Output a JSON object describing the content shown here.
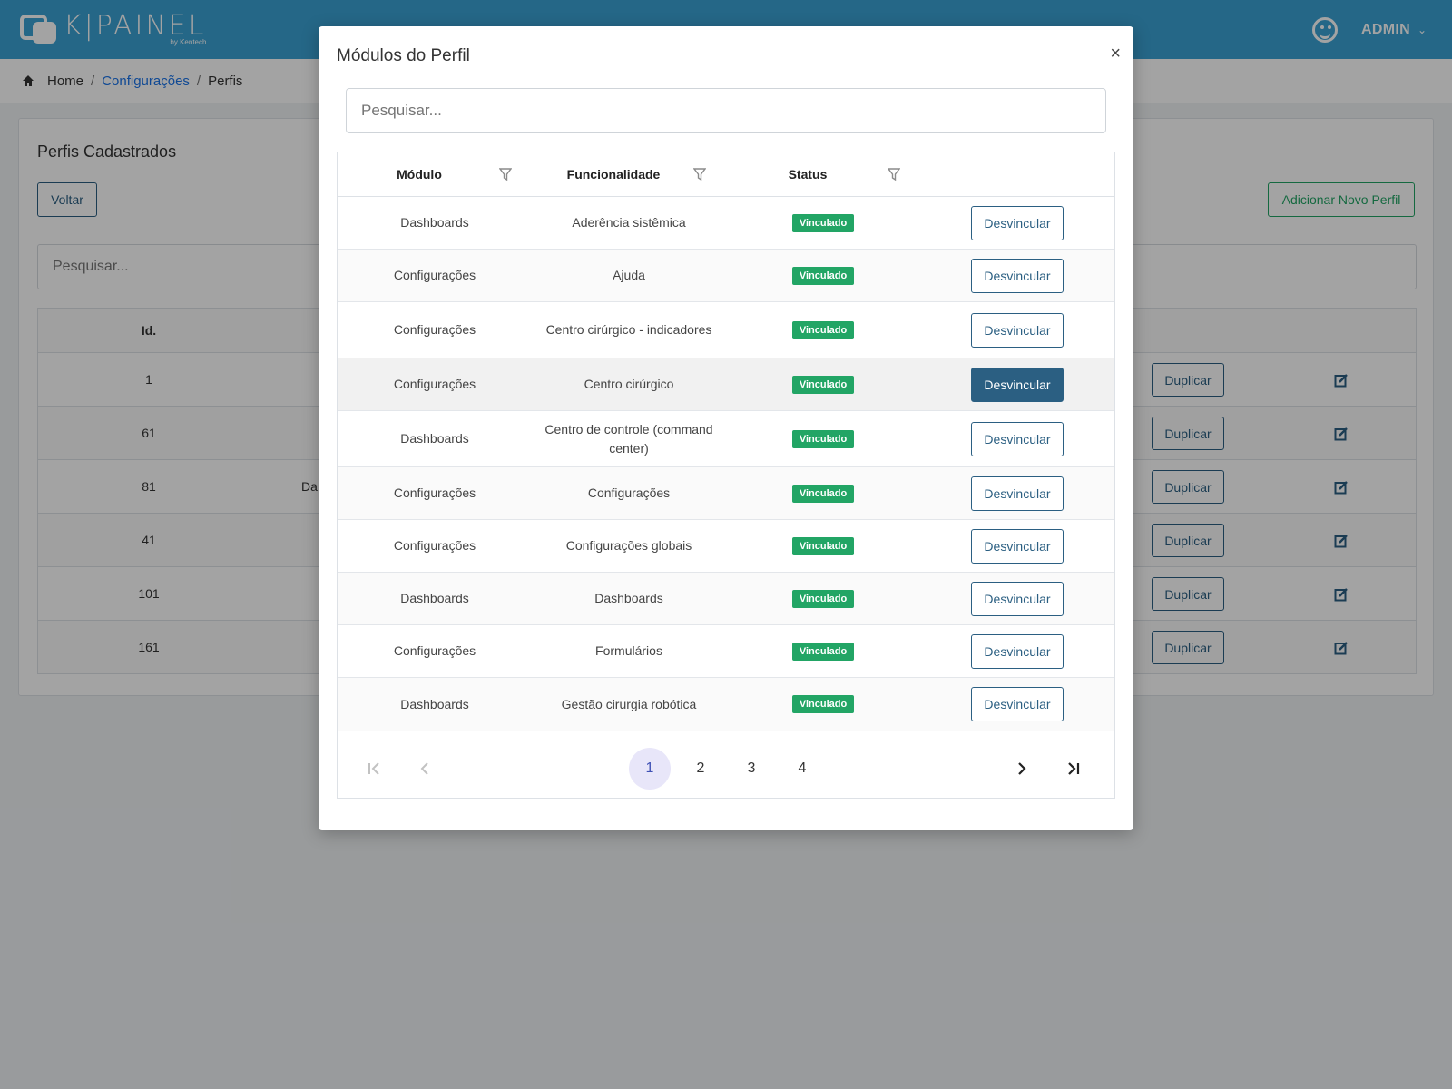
{
  "header": {
    "logo_text": "K|PAINEL",
    "logo_sub": "by Kentech",
    "user_name": "ADMIN"
  },
  "breadcrumb": {
    "home": "Home",
    "config": "Configurações",
    "current": "Perfis"
  },
  "main": {
    "title": "Perfis Cadastrados",
    "back_label": "Voltar",
    "add_label": "Adicionar Novo Perfil",
    "search_placeholder": "Pesquisar...",
    "col_id": "Id.",
    "rows": [
      {
        "id": "1",
        "name": ""
      },
      {
        "id": "61",
        "name": ""
      },
      {
        "id": "81",
        "name": "Da"
      },
      {
        "id": "41",
        "name": ""
      },
      {
        "id": "101",
        "name": ""
      },
      {
        "id": "161",
        "name": ""
      }
    ],
    "duplicate_label": "Duplicar"
  },
  "modal": {
    "title": "Módulos do Perfil",
    "close": "×",
    "search_placeholder": "Pesquisar...",
    "columns": {
      "module": "Módulo",
      "feature": "Funcionalidade",
      "status": "Status"
    },
    "unlink_label": "Desvincular",
    "rows": [
      {
        "module": "Dashboards",
        "feature": "Aderência sistêmica",
        "status": "Vinculado"
      },
      {
        "module": "Configurações",
        "feature": "Ajuda",
        "status": "Vinculado"
      },
      {
        "module": "Configurações",
        "feature": "Centro cirúrgico - indicadores",
        "status": "Vinculado"
      },
      {
        "module": "Configurações",
        "feature": "Centro cirúrgico",
        "status": "Vinculado"
      },
      {
        "module": "Dashboards",
        "feature": "Centro de controle (command center)",
        "status": "Vinculado"
      },
      {
        "module": "Configurações",
        "feature": "Configurações",
        "status": "Vinculado"
      },
      {
        "module": "Configurações",
        "feature": "Configurações globais",
        "status": "Vinculado"
      },
      {
        "module": "Dashboards",
        "feature": "Dashboards",
        "status": "Vinculado"
      },
      {
        "module": "Configurações",
        "feature": "Formulários",
        "status": "Vinculado"
      },
      {
        "module": "Dashboards",
        "feature": "Gestão cirurgia robótica",
        "status": "Vinculado"
      }
    ],
    "pagination": {
      "pages": [
        "1",
        "2",
        "3",
        "4"
      ],
      "current": "1"
    }
  },
  "colors": {
    "header": "#3aa1d3",
    "primary": "#2b5f82",
    "success": "#22a565"
  }
}
